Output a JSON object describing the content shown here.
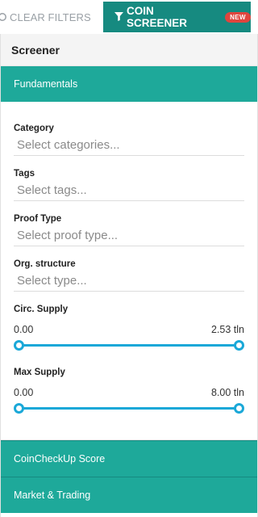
{
  "topbar": {
    "clear_filters_label": "CLEAR FILTERS",
    "coin_screener_label": "COIN SCREENER",
    "new_badge": "NEW"
  },
  "panel": {
    "title": "Screener"
  },
  "fundamentals": {
    "header": "Fundamentals",
    "category": {
      "label": "Category",
      "placeholder": "Select categories..."
    },
    "tags": {
      "label": "Tags",
      "placeholder": "Select tags..."
    },
    "proof_type": {
      "label": "Proof Type",
      "placeholder": "Select proof type..."
    },
    "org_structure": {
      "label": "Org. structure",
      "placeholder": "Select type..."
    },
    "circ_supply": {
      "label": "Circ. Supply",
      "min": "0.00",
      "max": "2.53 tln"
    },
    "max_supply": {
      "label": "Max Supply",
      "min": "0.00",
      "max": "8.00 tln"
    }
  },
  "sections": {
    "coincheckup_score": "CoinCheckUp Score",
    "market_trading": "Market & Trading"
  },
  "colors": {
    "accent_dark": "#168a80",
    "accent": "#1ea99a",
    "slider": "#1aa8d8",
    "badge": "#e0453e"
  }
}
